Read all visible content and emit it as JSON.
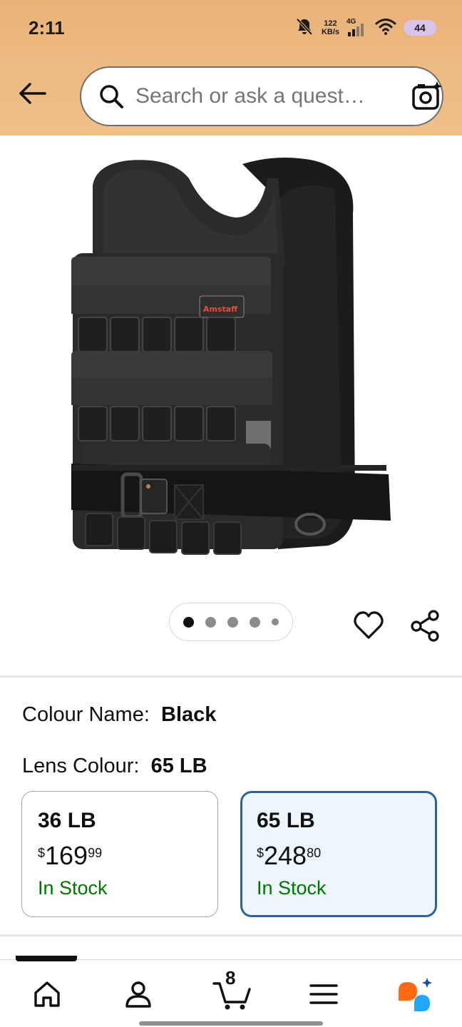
{
  "status_bar": {
    "time": "2:11",
    "net_speed_value": "122",
    "net_speed_unit": "KB/s",
    "network_type": "4G",
    "battery": "44"
  },
  "search": {
    "placeholder": "Search or ask a quest…"
  },
  "product": {
    "image_brand_label": "Amstaff",
    "image_count": 5,
    "active_image_index": 0
  },
  "variations": {
    "colour_label": "Colour Name:",
    "colour_value": "Black",
    "lens_label": "Lens Colour:",
    "lens_value": "65 LB",
    "options": [
      {
        "name": "36 LB",
        "currency": "$",
        "price_whole": "169",
        "price_fraction": "99",
        "availability": "In Stock",
        "selected": false
      },
      {
        "name": "65 LB",
        "currency": "$",
        "price_whole": "248",
        "price_fraction": "80",
        "availability": "In Stock",
        "selected": true
      }
    ]
  },
  "bottom_nav": {
    "cart_count": "8",
    "items": [
      "home-icon",
      "account-icon",
      "cart-icon",
      "menu-icon",
      "rufus-ai-icon"
    ]
  },
  "colors": {
    "header_bg": "#edbb84",
    "selected_border": "#2a6496",
    "selected_bg": "#edf6fc",
    "in_stock": "#007600"
  }
}
